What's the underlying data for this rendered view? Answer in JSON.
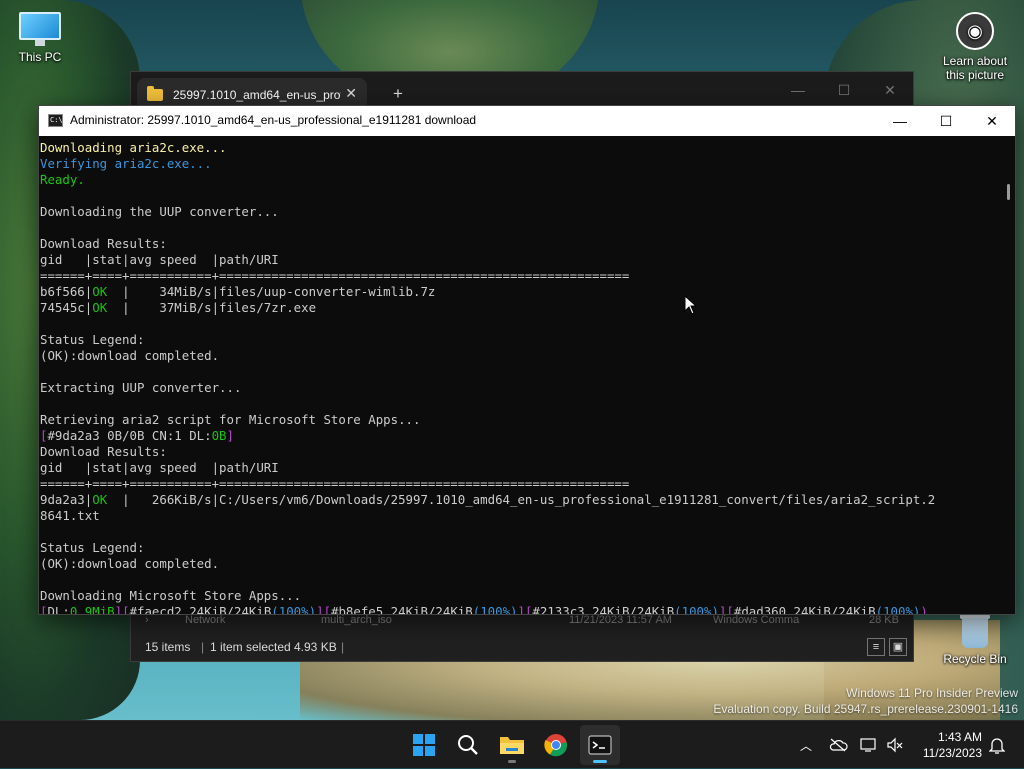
{
  "desktop": {
    "icons": [
      {
        "label": "This PC"
      },
      {
        "label": "Learn about this picture"
      },
      {
        "label": "Recycle Bin"
      }
    ],
    "watermark": {
      "line1": "Windows 11 Pro Insider Preview",
      "line2": "Evaluation copy. Build 25947.rs_prerelease.230901-1416"
    }
  },
  "explorer": {
    "tab_title": "25997.1010_amd64_en-us_prof",
    "tab_close": "✕",
    "new_tab": "+",
    "partial_row": {
      "nav_item": "Network",
      "file_name": "multi_arch_iso",
      "date": "11/21/2023 11:57 AM",
      "type": "Windows Comma",
      "size": "28 KB"
    },
    "status": {
      "items": "15 items",
      "selected": "1 item selected",
      "size": "4.93 KB"
    }
  },
  "terminal": {
    "title": "Administrator:  25997.1010_amd64_en-us_professional_e1911281 download",
    "icon_text": "C:\\",
    "lines": [
      [
        {
          "t": "Downloading aria2c.exe...",
          "c": "c-yellow"
        }
      ],
      [
        {
          "t": "Verifying aria2c.exe...",
          "c": "c-cyan"
        }
      ],
      [
        {
          "t": "Ready.",
          "c": "c-green"
        }
      ],
      [
        {
          "t": "",
          "c": "c-gray"
        }
      ],
      [
        {
          "t": "Downloading the UUP converter...",
          "c": "c-gray"
        }
      ],
      [
        {
          "t": "",
          "c": "c-gray"
        }
      ],
      [
        {
          "t": "Download Results:",
          "c": "c-gray"
        }
      ],
      [
        {
          "t": "gid   |stat|avg speed  |path/URI",
          "c": "c-gray"
        }
      ],
      [
        {
          "t": "======+====+===========+=======================================================",
          "c": "c-gray"
        }
      ],
      [
        {
          "t": "b6f566",
          "c": "c-gray"
        },
        {
          "t": "|",
          "c": "c-gray"
        },
        {
          "t": "OK",
          "c": "c-green"
        },
        {
          "t": "  |    34MiB/s|files/uup-converter-wimlib.7z",
          "c": "c-gray"
        }
      ],
      [
        {
          "t": "74545c",
          "c": "c-gray"
        },
        {
          "t": "|",
          "c": "c-gray"
        },
        {
          "t": "OK",
          "c": "c-green"
        },
        {
          "t": "  |    37MiB/s|files/7zr.exe",
          "c": "c-gray"
        }
      ],
      [
        {
          "t": "",
          "c": "c-gray"
        }
      ],
      [
        {
          "t": "Status Legend:",
          "c": "c-gray"
        }
      ],
      [
        {
          "t": "(OK):download completed.",
          "c": "c-gray"
        }
      ],
      [
        {
          "t": "",
          "c": "c-gray"
        }
      ],
      [
        {
          "t": "Extracting UUP converter...",
          "c": "c-gray"
        }
      ],
      [
        {
          "t": "",
          "c": "c-gray"
        }
      ],
      [
        {
          "t": "Retrieving aria2 script for Microsoft Store Apps...",
          "c": "c-gray"
        }
      ],
      [
        {
          "t": "[",
          "c": "c-purple"
        },
        {
          "t": "#9da2a3 0B/0B CN:1 DL:",
          "c": "c-gray"
        },
        {
          "t": "0B",
          "c": "c-green"
        },
        {
          "t": "]",
          "c": "c-purple"
        }
      ],
      [
        {
          "t": "Download Results:",
          "c": "c-gray"
        }
      ],
      [
        {
          "t": "gid   |stat|avg speed  |path/URI",
          "c": "c-gray"
        }
      ],
      [
        {
          "t": "======+====+===========+=======================================================",
          "c": "c-gray"
        }
      ],
      [
        {
          "t": "9da2a3",
          "c": "c-gray"
        },
        {
          "t": "|",
          "c": "c-gray"
        },
        {
          "t": "OK",
          "c": "c-green"
        },
        {
          "t": "  |   266KiB/s|C:/Users/vm6/Downloads/25997.1010_amd64_en-us_professional_e1911281_convert/files/aria2_script.2",
          "c": "c-gray"
        }
      ],
      [
        {
          "t": "8641.txt",
          "c": "c-gray"
        }
      ],
      [
        {
          "t": "",
          "c": "c-gray"
        }
      ],
      [
        {
          "t": "Status Legend:",
          "c": "c-gray"
        }
      ],
      [
        {
          "t": "(OK):download completed.",
          "c": "c-gray"
        }
      ],
      [
        {
          "t": "",
          "c": "c-gray"
        }
      ],
      [
        {
          "t": "Downloading Microsoft Store Apps...",
          "c": "c-gray"
        }
      ],
      [
        {
          "t": "[",
          "c": "c-purple"
        },
        {
          "t": "DL:",
          "c": "c-gray"
        },
        {
          "t": "0.9MiB",
          "c": "c-green"
        },
        {
          "t": "][",
          "c": "c-purple"
        },
        {
          "t": "#faecd2 24KiB/24KiB",
          "c": "c-gray"
        },
        {
          "t": "(100%)",
          "c": "c-cyan"
        },
        {
          "t": "][",
          "c": "c-purple"
        },
        {
          "t": "#b8efe5 24KiB/24KiB",
          "c": "c-gray"
        },
        {
          "t": "(100%)",
          "c": "c-cyan"
        },
        {
          "t": "][",
          "c": "c-purple"
        },
        {
          "t": "#2133c3 24KiB/24KiB",
          "c": "c-gray"
        },
        {
          "t": "(100%)",
          "c": "c-cyan"
        },
        {
          "t": "][",
          "c": "c-purple"
        },
        {
          "t": "#dad360 24KiB/24KiB",
          "c": "c-gray"
        },
        {
          "t": "(100%)",
          "c": "c-cyan"
        },
        {
          "t": ")",
          "c": "c-purple"
        }
      ]
    ]
  },
  "taskbar": {
    "apps": [
      "start-icon",
      "search-icon",
      "file-explorer-icon",
      "chrome-icon",
      "terminal-icon"
    ],
    "time": "1:43 AM",
    "date": "11/23/2023"
  }
}
